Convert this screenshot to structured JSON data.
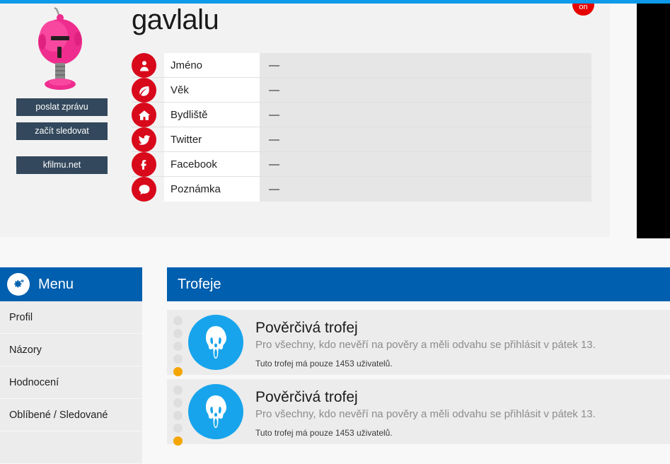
{
  "theme": {
    "accent_blue": "#0d9aea",
    "panel_blue": "#005fae",
    "icon_red": "#d8091a",
    "button_slate": "#33485c",
    "trophy_blue": "#17a4ec",
    "dot_active": "#f5a500",
    "badge_red": "#e60000"
  },
  "header": {
    "username": "gavlalu",
    "online_badge": "on"
  },
  "profile": {
    "avatar_alt": "robot-avatar",
    "buttons": {
      "message": "poslat zprávu",
      "follow": "začít sledovat",
      "site": "kfilmu.net"
    },
    "info_rows": [
      {
        "icon": "user-icon",
        "label": "Jméno",
        "value": "—"
      },
      {
        "icon": "leaf-icon",
        "label": "Věk",
        "value": "—"
      },
      {
        "icon": "home-icon",
        "label": "Bydliště",
        "value": "—"
      },
      {
        "icon": "twitter-icon",
        "label": "Twitter",
        "value": "—"
      },
      {
        "icon": "facebook-icon",
        "label": "Facebook",
        "value": "—"
      },
      {
        "icon": "comment-icon",
        "label": "Poznámka",
        "value": "—"
      }
    ]
  },
  "menu": {
    "title": "Menu",
    "icon": "gears-icon",
    "items": [
      {
        "label": "Profil"
      },
      {
        "label": "Názory"
      },
      {
        "label": "Hodnocení"
      },
      {
        "label": "Oblíbené / Sledované"
      },
      {
        "label": ""
      }
    ]
  },
  "trophies": {
    "title": "Trofeje",
    "items": [
      {
        "icon": "ghost-mask-icon",
        "name": "Pověrčivá trofej",
        "description": "Pro všechny, kdo nevěří na pověry a měli odvahu se přihlásit v pátek 13.",
        "count_text": "Tuto trofej má pouze 1453 uživatelů.",
        "dots_total": 5,
        "dots_active_index": 4
      },
      {
        "icon": "ghost-mask-icon",
        "name": "Pověrčivá trofej",
        "description": "Pro všechny, kdo nevěří na pověry a měli odvahu se přihlásit v pátek 13.",
        "count_text": "Tuto trofej má pouze 1453 uživatelů.",
        "dots_total": 5,
        "dots_active_index": 4
      }
    ]
  }
}
